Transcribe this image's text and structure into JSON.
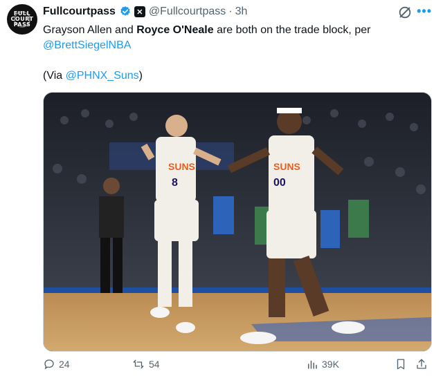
{
  "tweet": {
    "avatar_text": [
      "FULL",
      "COURT",
      "PASS"
    ],
    "name": "Fullcourtpass",
    "handle": "@Fullcourtpass",
    "separator": "·",
    "time": "3h",
    "text": {
      "part1": "Grayson Allen and ",
      "bold": "Royce O'Neale",
      "part2": " are both on the trade block, per ",
      "mention": "@BrettSiegelNBA",
      "via_prefix": "(Via ",
      "via_mention": "@PHNX_Suns",
      "via_suffix": ")"
    },
    "photo": {
      "player_left_number": "8",
      "player_right_number": "00",
      "jersey_text": "SUNS"
    },
    "stats": {
      "replies": "24",
      "retweets": "54",
      "views": "39K"
    }
  },
  "colors": {
    "accent": "#1d9bf0",
    "text": "#0f1419",
    "muted": "#536471",
    "court": "#c89a5e"
  }
}
